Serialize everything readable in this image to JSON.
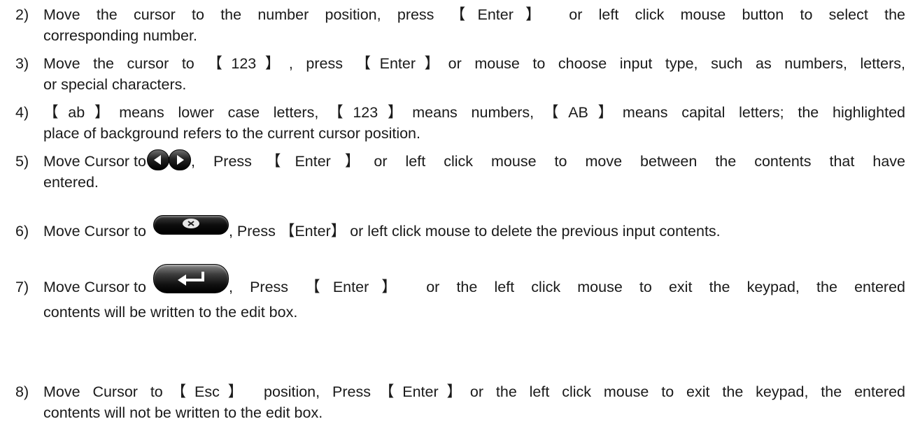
{
  "items": [
    {
      "num": "2)",
      "lines": [
        "Move the cursor to the number position, press 【Enter】 or left click mouse button to select the",
        "corresponding number."
      ]
    },
    {
      "num": "3)",
      "lines": [
        "Move the cursor to 【123】, press 【Enter】or mouse to choose input type, such as numbers, letters,",
        "or special characters."
      ]
    },
    {
      "num": "4)",
      "lines": [
        "【ab】means lower case letters,【123】means numbers,【AB】means capital letters; the highlighted",
        "place of background refers to the current cursor position."
      ]
    },
    {
      "num": "5)",
      "line1_before": "Move Cursor to",
      "line1_after": ", Press【Enter】or left click mouse to move between the contents that have",
      "line2": "entered.",
      "icon": "left-right-arrow-buttons-icon"
    },
    {
      "num": "6)",
      "line1_before": "Move Cursor to",
      "line1_after": ", Press 【Enter】 or left click mouse to delete the previous input contents.",
      "icon": "backspace-button-icon"
    },
    {
      "num": "7)",
      "line1_before": "Move Cursor to",
      "line1_after": ", Press 【Enter】 or the left click mouse to exit the keypad, the entered",
      "line2": "contents will be written to the edit box.",
      "icon": "enter-button-icon"
    },
    {
      "num": "8)",
      "lines": [
        "Move Cursor to【Esc】 position, Press【Enter】or the left click mouse to exit the keypad, the entered",
        "contents will not be written to the edit box."
      ]
    }
  ]
}
